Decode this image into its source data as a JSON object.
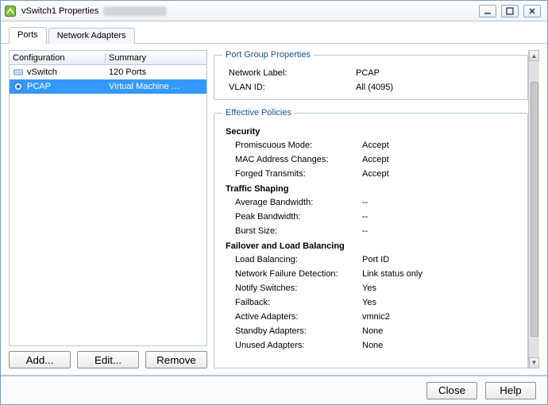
{
  "titlebar": {
    "app_icon": "vswitch-icon",
    "title": "vSwitch1 Properties"
  },
  "tabs": [
    {
      "label": "Ports",
      "active": true
    },
    {
      "label": "Network Adapters",
      "active": false
    }
  ],
  "config_list": {
    "headers": {
      "configuration": "Configuration",
      "summary": "Summary"
    },
    "rows": [
      {
        "icon": "vswitch-icon",
        "name": "vSwitch",
        "summary": "120 Ports",
        "selected": false
      },
      {
        "icon": "portgroup-icon",
        "name": "PCAP",
        "summary": "Virtual Machine …",
        "selected": true
      }
    ]
  },
  "left_buttons": {
    "add": "Add...",
    "edit": "Edit...",
    "remove": "Remove"
  },
  "port_group_props": {
    "legend": "Port Group Properties",
    "rows": [
      {
        "key": "Network Label:",
        "val": "PCAP"
      },
      {
        "key": "VLAN ID:",
        "val": "All (4095)"
      }
    ]
  },
  "effective_policies": {
    "legend": "Effective Policies",
    "sections": [
      {
        "header": "Security",
        "rows": [
          {
            "key": "Promiscuous Mode:",
            "val": "Accept"
          },
          {
            "key": "MAC Address Changes:",
            "val": "Accept"
          },
          {
            "key": "Forged Transmits:",
            "val": "Accept"
          }
        ]
      },
      {
        "header": "Traffic Shaping",
        "rows": [
          {
            "key": "Average Bandwidth:",
            "val": "--"
          },
          {
            "key": "Peak Bandwidth:",
            "val": "--"
          },
          {
            "key": "Burst Size:",
            "val": "--"
          }
        ]
      },
      {
        "header": "Failover and Load Balancing",
        "rows": [
          {
            "key": "Load Balancing:",
            "val": "Port ID"
          },
          {
            "key": "Network Failure Detection:",
            "val": "Link status only"
          },
          {
            "key": "Notify Switches:",
            "val": "Yes"
          },
          {
            "key": "Failback:",
            "val": "Yes"
          },
          {
            "key": "Active Adapters:",
            "val": "vmnic2"
          },
          {
            "key": "Standby Adapters:",
            "val": "None"
          },
          {
            "key": "Unused Adapters:",
            "val": "None"
          }
        ]
      }
    ]
  },
  "footer": {
    "close": "Close",
    "help": "Help"
  }
}
